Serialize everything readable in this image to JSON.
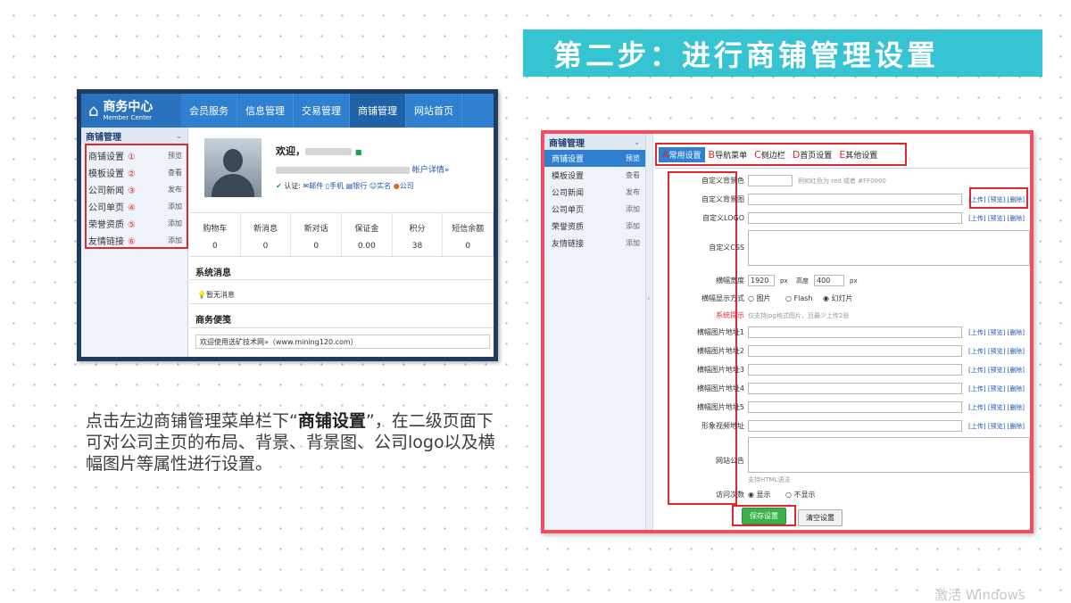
{
  "title_banner": "第二步：进行商铺管理设置",
  "left_shot": {
    "logo": {
      "main": "商务中心",
      "sub": "Member Center"
    },
    "nav_tabs": [
      "会员服务",
      "信息管理",
      "交易管理",
      "商铺管理",
      "网站首页"
    ],
    "active_tab_index": 3,
    "sidebar_title": "商铺管理",
    "sidebar_items": [
      {
        "label": "商铺设置",
        "num": "①",
        "action": "预览"
      },
      {
        "label": "模板设置",
        "num": "②",
        "action": "查看"
      },
      {
        "label": "公司新闻",
        "num": "③",
        "action": "发布"
      },
      {
        "label": "公司单页",
        "num": "④",
        "action": "添加"
      },
      {
        "label": "荣誉资质",
        "num": "⑤",
        "action": "添加"
      },
      {
        "label": "友情链接",
        "num": "⑥",
        "action": "添加"
      }
    ],
    "welcome": "欢迎，",
    "account_detail": "帐户详情»",
    "cert_label": "认证:",
    "cert_items": [
      "邮件",
      "手机",
      "银行",
      "实名",
      "公司"
    ],
    "stats": [
      {
        "label": "购物车",
        "value": "0"
      },
      {
        "label": "新消息",
        "value": "0"
      },
      {
        "label": "新对话",
        "value": "0"
      },
      {
        "label": "保证金",
        "value": "0.00"
      },
      {
        "label": "积分",
        "value": "38"
      },
      {
        "label": "短信余额",
        "value": "0"
      }
    ],
    "sys_msg_title": "系统消息",
    "sys_msg_text": "暂无消息",
    "memo_title": "商务便笺",
    "memo_text": "欢迎使用选矿技术网»（www.mining120.com）"
  },
  "description": {
    "pre": "点击左边商铺管理菜单栏下",
    "open_quote": "“",
    "bold": "商铺设置",
    "close_quote": "”",
    "post": "，在二级页面下可对公司主页的布局、背景、背景图、公司logo以及横幅图片等属性进行设置。"
  },
  "right_shot": {
    "sidebar_title": "商铺管理",
    "sidebar_items": [
      {
        "label": "商铺设置",
        "action": "预览"
      },
      {
        "label": "模板设置",
        "action": "查看"
      },
      {
        "label": "公司新闻",
        "action": "发布"
      },
      {
        "label": "公司单页",
        "action": "添加"
      },
      {
        "label": "荣誉资质",
        "action": "添加"
      },
      {
        "label": "友情链接",
        "action": "添加"
      }
    ],
    "tabs": [
      {
        "key": "A",
        "label": "常用设置"
      },
      {
        "key": "B",
        "label": "导航菜单"
      },
      {
        "key": "C",
        "label": "侧边栏"
      },
      {
        "key": "D",
        "label": "首页设置"
      },
      {
        "key": "E",
        "label": "其他设置"
      }
    ],
    "labels": {
      "bg_color": "自定义背景色",
      "bg_image": "自定义背景图",
      "logo": "自定义LOGO",
      "css": "自定义CSS",
      "banner_width": "横幅宽度",
      "banner_mode": "横幅显示方式",
      "sys_tip": "系统提示",
      "banner1": "横幅图片地址1",
      "banner2": "横幅图片地址2",
      "banner3": "横幅图片地址3",
      "banner4": "横幅图片地址4",
      "banner5": "横幅图片地址5",
      "video": "形象视频地址",
      "notice": "网站公告",
      "visits": "访问次数"
    },
    "bg_color_hint": "例如红色为 red 或者 #FF0000",
    "link_upload": "[上传]",
    "link_preview": "[预览]",
    "link_delete": "[删除]",
    "banner_width_value": "1920",
    "banner_height_label": "高度",
    "banner_height_value": "400",
    "unit_px": "px",
    "mode_options": [
      "图片",
      "Flash",
      "幻灯片"
    ],
    "sys_tip_text": "仅支持jpg格式图片，且最少上传2张",
    "notice_hint": "支持HTML语法",
    "visit_options": [
      "显示",
      "不显示"
    ],
    "save_label": "保存设置",
    "clear_label": "清空设置"
  },
  "watermark": "激活 Windows"
}
